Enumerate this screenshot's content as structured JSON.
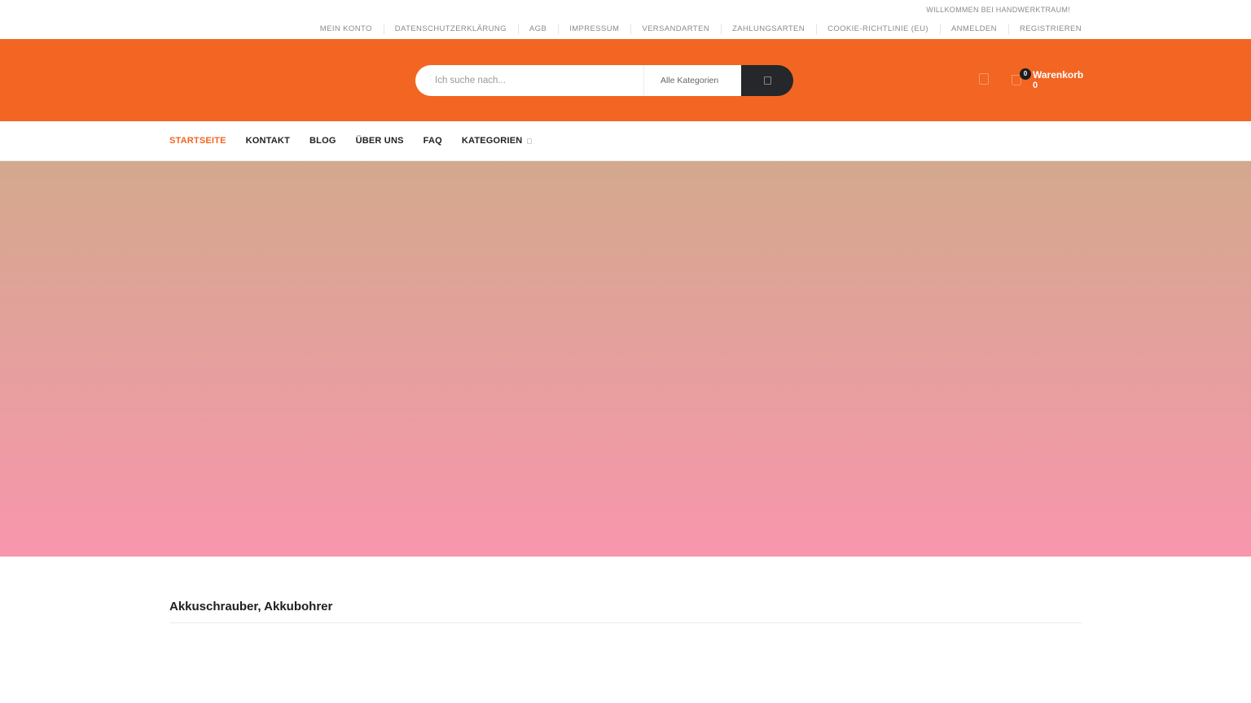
{
  "top_bar": {
    "welcome": "WILLKOMMEN BEI HANDWERKTRAUM!",
    "links": [
      "MEIN KONTO",
      "DATENSCHUTZERKLÄRUNG",
      "AGB",
      "IMPRESSUM",
      "VERSANDARTEN",
      "ZAHLUNGSARTEN",
      "COOKIE-RICHTLINIE (EU)",
      "ANMELDEN",
      "REGISTRIEREN"
    ]
  },
  "header": {
    "search": {
      "placeholder": "Ich suche nach...",
      "category_select": "Alle Kategorien",
      "button_icon": "search-icon"
    },
    "wishlist_icon": "heart-icon",
    "cart": {
      "icon": "shopping-bag-icon",
      "badge_count": "0",
      "label": "Warenkorb",
      "total": "0"
    }
  },
  "main_nav": {
    "items": [
      "STARTSEITE",
      "KONTAKT",
      "BLOG",
      "ÜBER UNS",
      "FAQ",
      "KATEGORIEN"
    ],
    "active_index": 0,
    "dropdown_icon": "chevron-down-icon"
  },
  "section": {
    "title": "Akkuschrauber, Akkubohrer"
  },
  "colors": {
    "brand": "#f26522",
    "dark": "#25272b",
    "nav_text": "#222222",
    "nav_active": "#f26522",
    "hero_top": "#d3a98d",
    "hero_bottom": "#f896ad"
  }
}
